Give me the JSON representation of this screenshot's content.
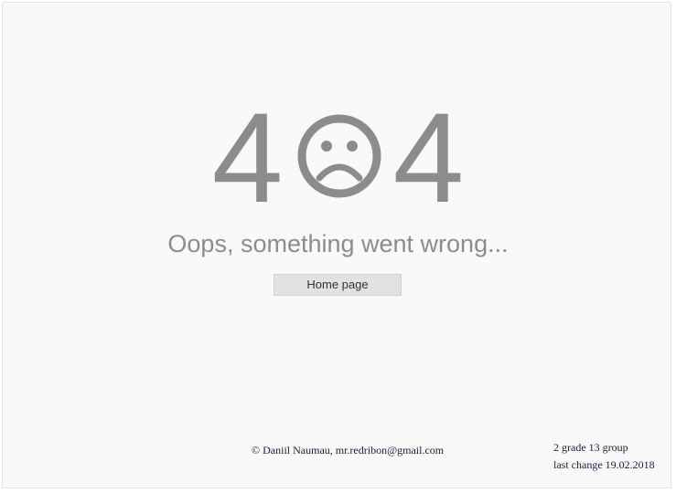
{
  "error": {
    "digit_left": "4",
    "digit_right": "4",
    "face_icon": "sad-face-icon",
    "color": "#8c8c8c"
  },
  "message": "Oops, something went wrong...",
  "home_button": {
    "label": "Home page"
  },
  "footer": {
    "copyright": "© Daniil Naumau, mr.redribon@gmail.com",
    "group": "2 grade 13 group",
    "last_change": "last change 19.02.2018"
  }
}
